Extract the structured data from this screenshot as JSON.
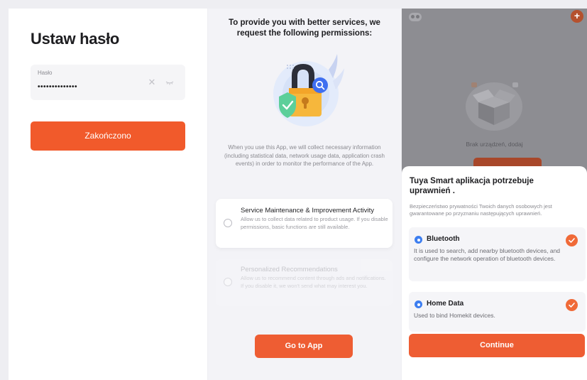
{
  "panel_password": {
    "title": "Ustaw hasło",
    "field_label": "Hasło",
    "field_value": "••••••••••••••",
    "clear_icon": "close-icon",
    "eye_icon": "eye-closed-icon",
    "submit_label": "Zakończono"
  },
  "panel_privacy": {
    "title": "To provide you with better services, we request the following permissions:",
    "description": "When you use this App, we will collect necessary information (including statistical data, network usage data, application crash events) in order to monitor the performance of the App.",
    "options": [
      {
        "title": "Service Maintenance & Improvement Activity",
        "desc": "Allow us to collect data related to product usage. If you disable permissions, basic functions are still available."
      },
      {
        "title": "Personalized Recommendations",
        "desc": "Allow us to recommend content through ads and notifications. If you disable it, we won't send what may interest you."
      }
    ],
    "button_label": "Go to App"
  },
  "panel_permissions": {
    "empty_text": "Brak urządzeń, dodaj",
    "sheet_title": "Tuya Smart aplikacja potrzebuje uprawnień .",
    "sheet_subtitle": "Bezpieczeństwo prywatności Twoich danych osobowych jest gwarantowane po przyznaniu następujących uprawnień.",
    "permissions": [
      {
        "title": "Bluetooth",
        "desc": "It is used to search, add nearby bluetooth devices, and configure the network operation of bluetooth devices."
      },
      {
        "title": "Home Data",
        "desc": "Used to bind Homekit devices."
      }
    ],
    "button_label": "Continue"
  },
  "colors": {
    "accent": "#f15a2b",
    "check": "#f06a38",
    "info_blue": "#3d7ef0"
  }
}
